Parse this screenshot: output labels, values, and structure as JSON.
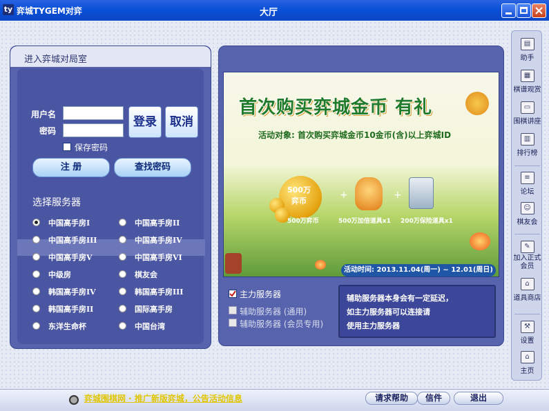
{
  "titlebar": {
    "app_title": "弈城TYGEM对弈",
    "window_title": "大厅",
    "logo_glyph": "ty"
  },
  "login": {
    "header": "进入弈城对局室",
    "username_label": "用户名",
    "password_label": "密码",
    "username_value": "",
    "password_value": "",
    "login_button": "登录",
    "cancel_button": "取消",
    "save_password_label": "保存密码",
    "save_password_checked": false,
    "register_button": "注 册",
    "find_password_button": "查找密码",
    "server_section_title": "选择服务器",
    "servers": [
      {
        "label": "中国高手房I",
        "selected": true
      },
      {
        "label": "中国高手房II",
        "selected": false
      },
      {
        "label": "中国高手房III",
        "selected": false
      },
      {
        "label": "中国高手房IV",
        "selected": false
      },
      {
        "label": "中国高手房V",
        "selected": false
      },
      {
        "label": "中国高手房VI",
        "selected": false
      },
      {
        "label": "中级房",
        "selected": false
      },
      {
        "label": "棋友会",
        "selected": false
      },
      {
        "label": "韩国高手房IV",
        "selected": false
      },
      {
        "label": "韩国高手房III",
        "selected": false
      },
      {
        "label": "韩国高手房II",
        "selected": false
      },
      {
        "label": "国际高手房",
        "selected": false
      },
      {
        "label": "东洋生命杯",
        "selected": false
      },
      {
        "label": "中国台湾",
        "selected": false
      }
    ]
  },
  "promo": {
    "title": "首次购买弈城金币 有礼",
    "subtitle": "活动对象: 首次购买弈城金币10金币(含)以上弈城ID",
    "coin_badge_line1": "500万",
    "coin_badge_line2": "弈币",
    "prizes": [
      "500万弈币",
      "500万加倍道具x1",
      "200万保险道具x1"
    ],
    "date": "活动时间: 2013.11.04(周一) ~ 12.01(周日)"
  },
  "server_options": {
    "main": {
      "label": "主力服务器",
      "checked": true
    },
    "aux_general": {
      "label": "辅助服务器 (通用)",
      "checked": false
    },
    "aux_member": {
      "label": "辅助服务器 (会员专用)",
      "checked": false
    }
  },
  "notice": {
    "lines": [
      "辅助服务器本身会有一定延迟，",
      "如主力服务器可以连接请",
      "使用主力服务器"
    ]
  },
  "sidebar": [
    {
      "label": "助手",
      "icon": "assistant-icon"
    },
    {
      "label": "棋谱观赏",
      "icon": "game-record-icon"
    },
    {
      "label": "围棋讲座",
      "icon": "lecture-tv-icon"
    },
    {
      "label": "排行榜",
      "icon": "ranking-icon"
    },
    {
      "label": "论坛",
      "icon": "forum-icon"
    },
    {
      "label": "棋友会",
      "icon": "club-icon"
    },
    {
      "label": "加入正式会员",
      "icon": "join-member-icon"
    },
    {
      "label": "道具商店",
      "icon": "shop-icon"
    },
    {
      "label": "设置",
      "icon": "settings-icon"
    },
    {
      "label": "主页",
      "icon": "home-icon"
    }
  ],
  "bottom": {
    "marquee": "弈城围棋网 · 推广新版弈城，公告活动信息",
    "help_button": "请求帮助",
    "mail_button": "信件",
    "exit_button": "退出"
  }
}
